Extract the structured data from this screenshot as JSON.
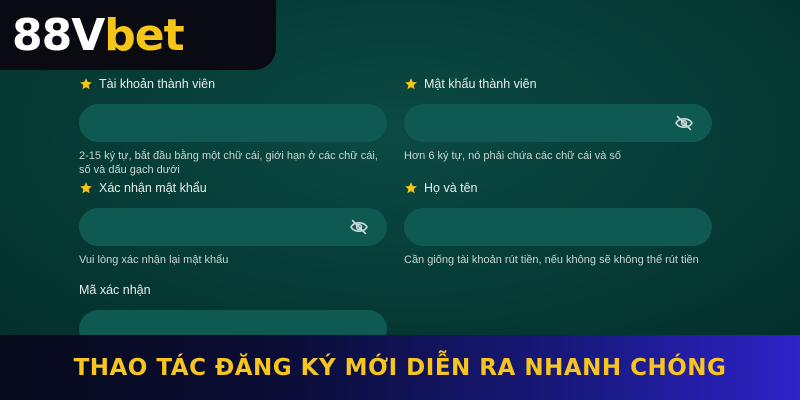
{
  "brand": {
    "logo_part1": "88V",
    "logo_part2": "bet"
  },
  "form": {
    "fields": [
      {
        "label": "Tài khoản thành viên",
        "hint": "2-15 ký tự, bắt đầu bằng một chữ cái, giới hạn ở các chữ cái, số và dấu gạch dưới",
        "value": "",
        "required": true,
        "has_eye_icon": false
      },
      {
        "label": "Mật khẩu thành viên",
        "hint": "Hơn 6 ký tự, nó phải chứa các chữ cái và số",
        "value": "",
        "required": true,
        "has_eye_icon": true
      },
      {
        "label": "Xác nhận mật khẩu",
        "hint": "Vui lòng xác nhận lại mật khẩu",
        "value": "",
        "required": true,
        "has_eye_icon": true
      },
      {
        "label": "Họ và tên",
        "hint": "Cần giống tài khoản rút tiền, nếu không sẽ không thể rút tiền",
        "value": "",
        "required": true,
        "has_eye_icon": false
      },
      {
        "label": "Mã xác nhận",
        "value": "",
        "required": false,
        "has_eye_icon": false
      }
    ]
  },
  "banner": {
    "text": "THAO TÁC ĐĂNG KÝ MỚI DIỄN RA NHANH CHÓNG"
  },
  "colors": {
    "background": "#063b36",
    "input_fill": "#0e5a52",
    "star": "#f5c518",
    "banner_text": "#f7c51d",
    "banner_gradient_end": "#2e22c9"
  },
  "icons": {
    "required": "star-icon",
    "password_toggle": "eye-off-icon"
  }
}
